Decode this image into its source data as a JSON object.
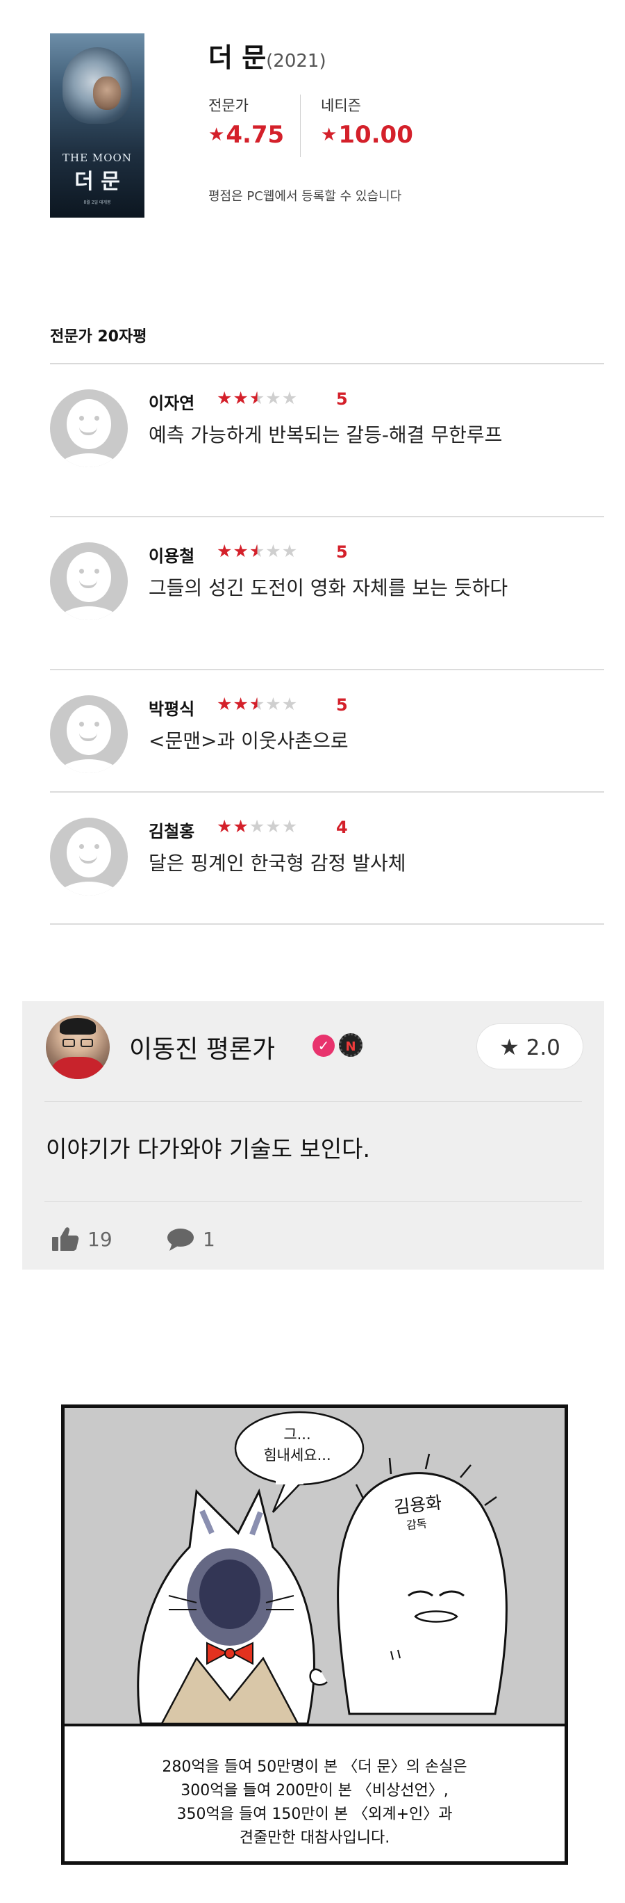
{
  "movie": {
    "title": "더 문",
    "year": "(2021)",
    "poster": {
      "tagline": "THE MOON",
      "title": "더 문",
      "footer": "8월 2일 대개봉"
    },
    "scores": {
      "pro_label": "전문가",
      "pro_value": "4.75",
      "net_label": "네티즌",
      "net_value": "10.00"
    },
    "note": "평점은 PC웹에서 등록할 수 있습니다"
  },
  "critics": {
    "heading": "전문가 20자평",
    "reviews": [
      {
        "name": "이자연",
        "stars_full": 2,
        "stars_half": 1,
        "score": "5",
        "text": "예측 가능하게 반복되는 갈등-해결 무한루프"
      },
      {
        "name": "이용철",
        "stars_full": 2,
        "stars_half": 1,
        "score": "5",
        "text": "그들의 성긴 도전이 영화 자체를 보는 듯하다"
      },
      {
        "name": "박평식",
        "stars_full": 2,
        "stars_half": 1,
        "score": "5",
        "text": "<문맨>과 이웃사촌으로"
      },
      {
        "name": "김철홍",
        "stars_full": 2,
        "stars_half": 0,
        "score": "4",
        "text": "달은 핑계인 한국형 감정 발사체"
      }
    ]
  },
  "critic_card": {
    "name": "이동진 평론가",
    "rating": "2.0",
    "review": "이야기가 다가와야 기술도 보인다.",
    "likes": "19",
    "comments": "1",
    "verify_badge": "✓",
    "n_badge": "N"
  },
  "comic": {
    "bubble_lines": [
      "그...",
      "힘내세요..."
    ],
    "sign_name": "김용화",
    "sign_role": "감독",
    "caption_lines": [
      "280억을 들여 50만명이 본 〈더 문〉의 손실은",
      "300억을 들여 200만이 본 〈비상선언〉,",
      "350억을 들여 150만이 본 〈외계+인〉과",
      "견줄만한 대참사입니다."
    ]
  },
  "colors": {
    "accent": "#d4202a",
    "star_off": "#cfcfcf",
    "card_bg": "#efefef"
  },
  "icons": {
    "star": "★",
    "thumb": "thumbs-up-icon",
    "comment": "comment-bubble-icon"
  }
}
